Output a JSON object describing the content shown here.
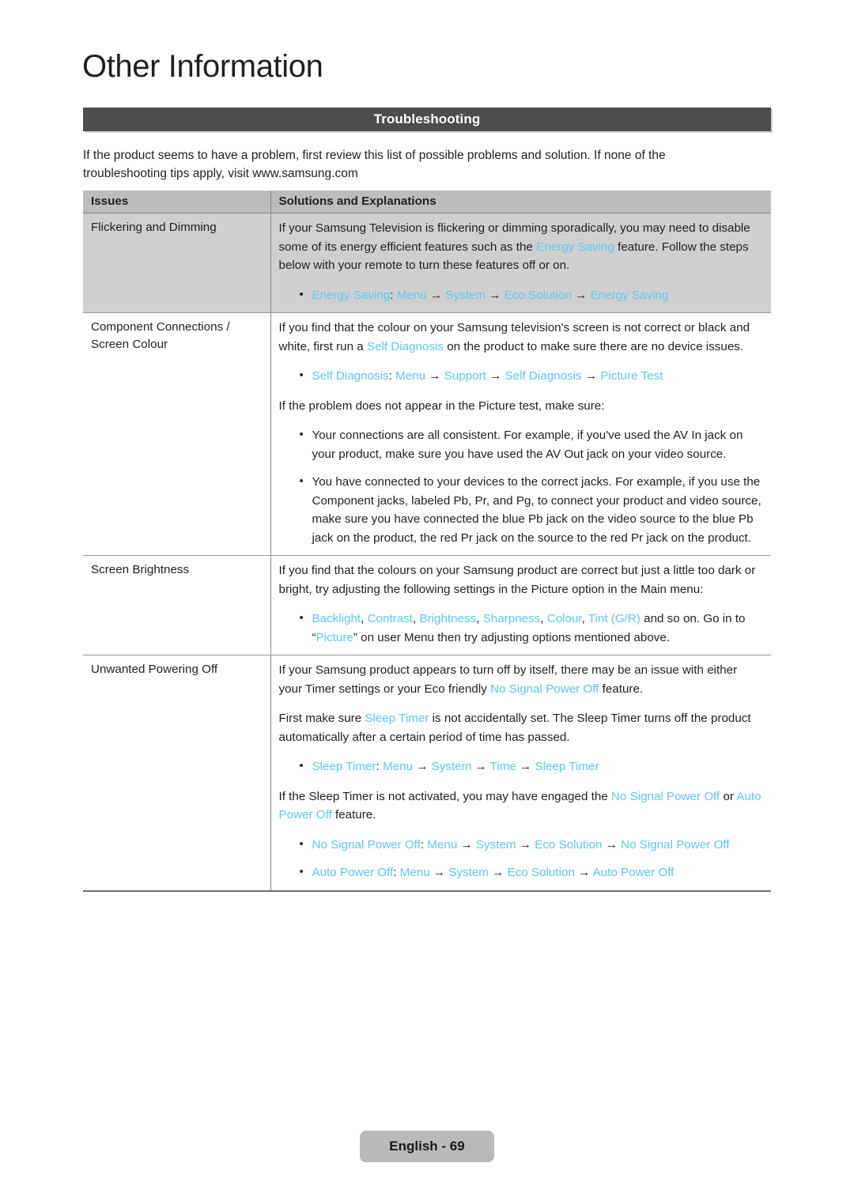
{
  "page": {
    "chapter_title": "Other Information",
    "section_banner": "Troubleshooting",
    "intro": "If the product seems to have a problem, first review this list of possible problems and solution. If none of the troubleshooting tips apply, visit www.samsung.com",
    "footer": "English - 69"
  },
  "colors": {
    "accent": "#5ec8f0",
    "banner_bg": "#4d4d4d",
    "table_header_bg": "#bcbcbc",
    "shaded_row_bg": "#cfcfcf",
    "footer_pill_bg": "#b9b9b9",
    "text": "#231f20"
  },
  "table": {
    "headers": {
      "issues": "Issues",
      "solutions": "Solutions and Explanations"
    },
    "rows": [
      {
        "issue": "Flickering and Dimming",
        "paras": {
          "p1_a": "If your Samsung Television is flickering or dimming sporadically, you may need to disable some of its energy efficient features such as the ",
          "p1_accent": "Energy Saving",
          "p1_b": " feature. Follow the steps below with your remote to turn these features off or on."
        },
        "path": {
          "label": "Energy Saving",
          "colon": ": ",
          "steps": [
            "Menu",
            "System",
            "Eco Solution",
            "Energy Saving"
          ]
        }
      },
      {
        "issue_line1": "Component Connections /",
        "issue_line2": "Screen Colour",
        "paras": {
          "p1_a": "If you find that the colour on your Samsung television's screen is not correct or black and white, first run a ",
          "p1_accent": "Self Diagnosis",
          "p1_b": " on the product to make sure there are no device issues.",
          "p2": "If the problem does not appear in the Picture test, make sure:"
        },
        "path": {
          "label": "Self Diagnosis",
          "colon": ": ",
          "steps": [
            "Menu",
            "Support",
            "Self Diagnosis",
            "Picture Test"
          ]
        },
        "bullets": [
          "Your connections are all consistent. For example, if you've used the AV In jack on your product, make sure you have used the AV Out jack on your video source.",
          "You have connected to your devices to the correct jacks. For example, if you use the Component jacks, labeled Pb, Pr, and Pg, to connect your product and video source, make sure you have connected the blue Pb jack on the video source to the blue Pb jack on the product, the red Pr jack on the source to the red Pr jack on the product."
        ]
      },
      {
        "issue": "Screen Brightness",
        "paras": {
          "p1": "If you find that the colours on your Samsung product are correct but just a little too dark or bright, try adjusting the following settings in the Picture option in the Main menu:"
        },
        "settings_bullet": {
          "items": [
            "Backlight",
            "Contrast",
            "Brightness",
            "Sharpness",
            "Colour",
            "Tint (G/R)"
          ],
          "separator": ", ",
          "tail_a": " and so on. Go in to “",
          "tail_accent": "Picture",
          "tail_b": "” on user Menu then try adjusting options mentioned above."
        }
      },
      {
        "issue": "Unwanted Powering Off",
        "paras": {
          "p1_a": "If your Samsung product appears to turn off by itself, there may be an issue with either your Timer settings or your Eco friendly ",
          "p1_accent": "No Signal Power Off",
          "p1_b": " feature.",
          "p2_a": "First make sure ",
          "p2_accent": "Sleep Timer",
          "p2_b": " is not accidentally set. The Sleep Timer turns off the product automatically after a certain period of time has passed.",
          "p3_a": "If the Sleep Timer is not activated, you may have engaged the ",
          "p3_accent1": "No Signal Power Off",
          "p3_mid": " or ",
          "p3_accent2": "Auto Power Off",
          "p3_b": " feature."
        },
        "path_sleep": {
          "label": "Sleep Timer",
          "colon": ": ",
          "steps": [
            "Menu",
            "System",
            "Time",
            "Sleep Timer"
          ]
        },
        "path_nosignal": {
          "label": "No Signal Power Off",
          "colon": ": ",
          "steps": [
            "Menu",
            "System",
            "Eco Solution",
            "No Signal Power Off"
          ]
        },
        "path_autopower": {
          "label": "Auto Power Off",
          "colon": ": ",
          "steps": [
            "Menu",
            "System",
            "Eco Solution",
            "Auto Power Off"
          ]
        }
      }
    ]
  }
}
